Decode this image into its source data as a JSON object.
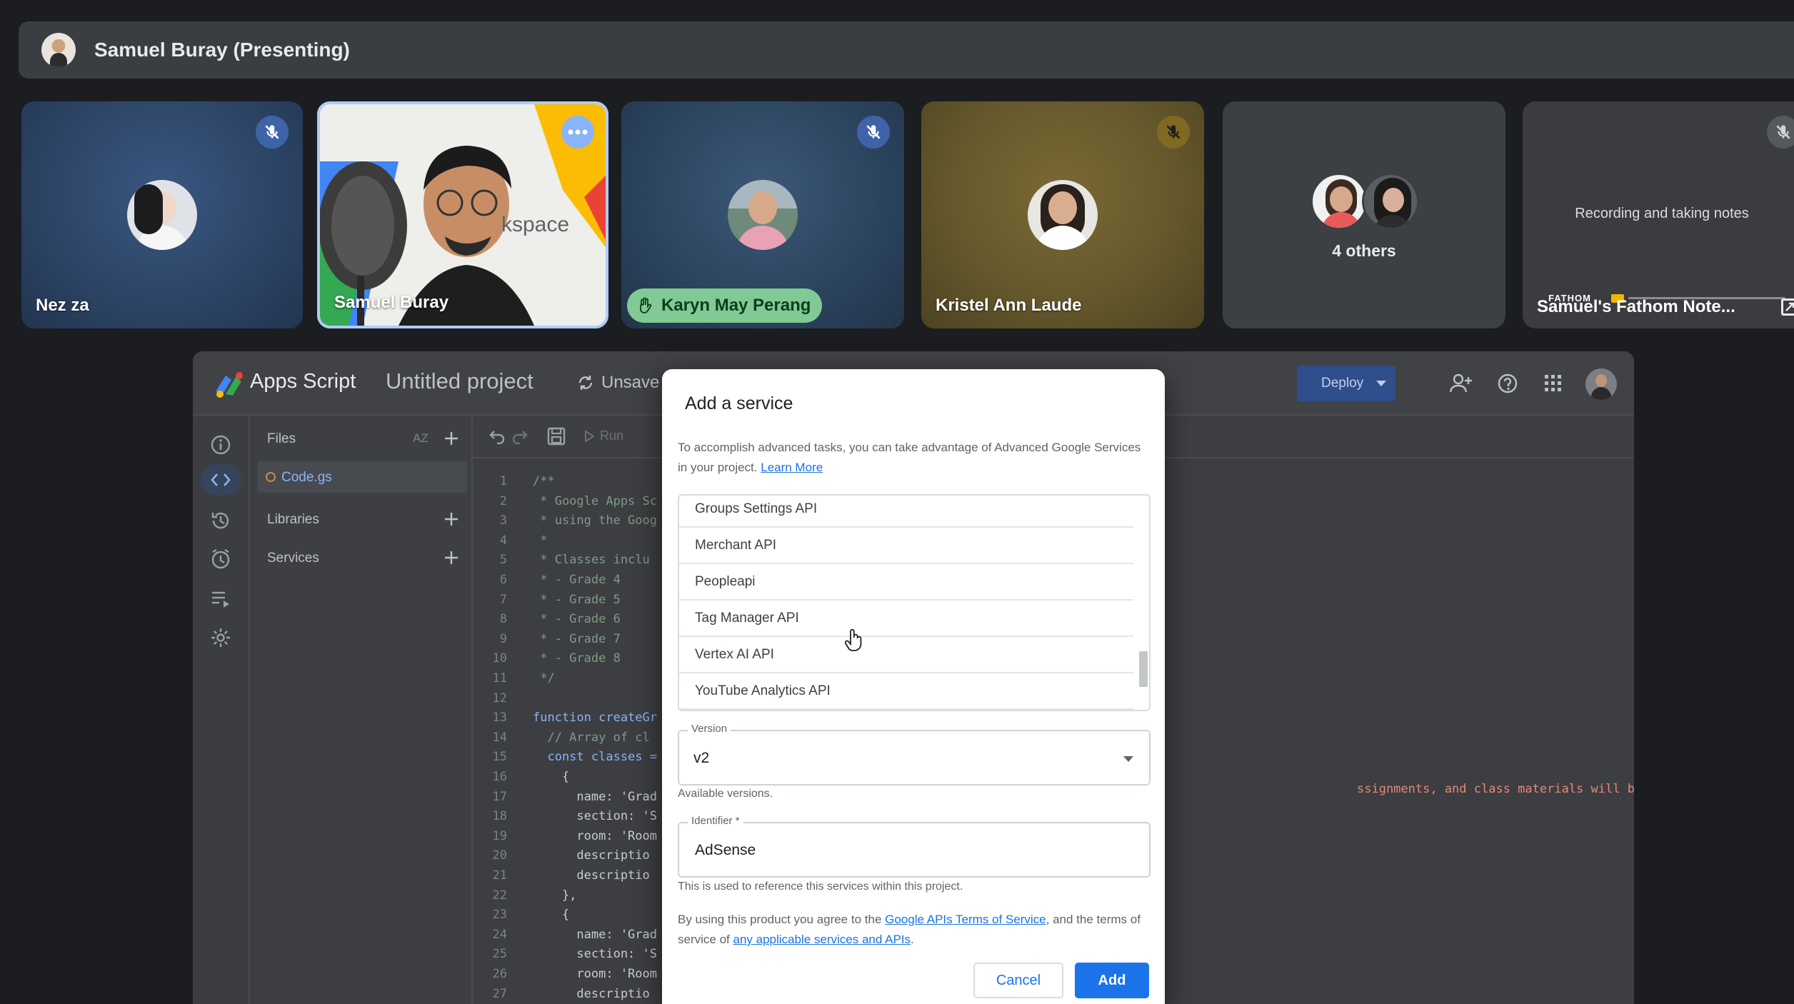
{
  "meet": {
    "presenting_title": "Samuel Buray (Presenting)",
    "tiles": [
      {
        "name": "Nez za"
      },
      {
        "name": "Samuel Buray",
        "overlay_text": "kspace"
      },
      {
        "name": "Karyn May Perang"
      },
      {
        "name": "Kristel Ann Laude"
      },
      {
        "name": "4 others"
      },
      {
        "status": "Recording and taking notes",
        "name": "Samuel's Fathom Note...",
        "brand": "FATHOM"
      }
    ]
  },
  "editor": {
    "app_name": "Apps Script",
    "project_title": "Untitled project",
    "unsaved_label": "Unsave",
    "deploy_label": "Deploy",
    "files_label": "Files",
    "sort_label": "AZ",
    "run_label": "Run",
    "file_name": "Code.gs",
    "libraries_label": "Libraries",
    "services_label": "Services",
    "visible_string_tail": "ssignments, and class materials will be posted here.\"",
    "code_lines": [
      {
        "n": "1",
        "t": "/**"
      },
      {
        "n": "2",
        "t": " * Google Apps Sc"
      },
      {
        "n": "3",
        "t": " * using the Goog"
      },
      {
        "n": "4",
        "t": " *"
      },
      {
        "n": "5",
        "t": " * Classes inclu"
      },
      {
        "n": "6",
        "t": " * - Grade 4"
      },
      {
        "n": "7",
        "t": " * - Grade 5"
      },
      {
        "n": "8",
        "t": " * - Grade 6"
      },
      {
        "n": "9",
        "t": " * - Grade 7"
      },
      {
        "n": "10",
        "t": " * - Grade 8"
      },
      {
        "n": "11",
        "t": " */"
      },
      {
        "n": "12",
        "t": ""
      },
      {
        "n": "13",
        "t": "function createGr"
      },
      {
        "n": "14",
        "t": "  // Array of cl"
      },
      {
        "n": "15",
        "t": "  const classes ="
      },
      {
        "n": "16",
        "t": "    {"
      },
      {
        "n": "17",
        "t": "      name: 'Grad"
      },
      {
        "n": "18",
        "t": "      section: 'S"
      },
      {
        "n": "19",
        "t": "      room: 'Room"
      },
      {
        "n": "20",
        "t": "      descriptio"
      },
      {
        "n": "21",
        "t": "      descriptio"
      },
      {
        "n": "22",
        "t": "    },"
      },
      {
        "n": "23",
        "t": "    {"
      },
      {
        "n": "24",
        "t": "      name: 'Grad"
      },
      {
        "n": "25",
        "t": "      section: 'S"
      },
      {
        "n": "26",
        "t": "      room: 'Room"
      },
      {
        "n": "27",
        "t": "      descriptio"
      }
    ]
  },
  "dialog": {
    "title": "Add a service",
    "desc": "To accomplish advanced tasks, you can take advantage of Advanced Google Services in your project.",
    "learn_more": "Learn More",
    "services": [
      "Groups Settings API",
      "Merchant API",
      "Peopleapi",
      "Tag Manager API",
      "Vertex AI API",
      "YouTube Analytics API"
    ],
    "version_label": "Version",
    "version_value": "v2",
    "version_hint": "Available versions.",
    "identifier_label": "Identifier *",
    "identifier_value": "AdSense",
    "identifier_hint": "This is used to reference this services within this project.",
    "terms_pre": "By using this product you agree to the ",
    "terms_link1": "Google APIs Terms of Service",
    "terms_mid": ", and the terms of service of ",
    "terms_link2": "any applicable services and APIs",
    "terms_post": ".",
    "cancel_label": "Cancel",
    "add_label": "Add"
  },
  "colors": {
    "accent": "#1a73e8",
    "raise_hand": "#81c995",
    "tile_blue": "#2f4a6d",
    "tile_gold": "#6a5b2e"
  }
}
